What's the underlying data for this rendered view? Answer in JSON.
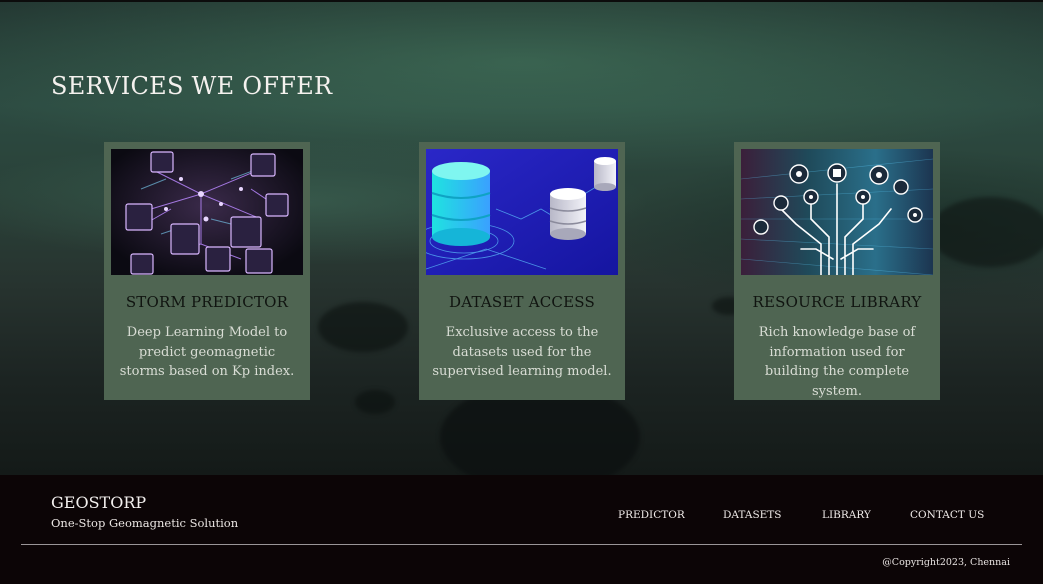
{
  "services": {
    "title": "SERVICES WE OFFER",
    "cards": [
      {
        "title": "STORM PREDICTOR",
        "description": "Deep Learning Model to predict geomagnetic storms based on Kp index.",
        "image": "network-cubes-illustration"
      },
      {
        "title": "DATASET ACCESS",
        "description": "Exclusive access to the datasets used for the supervised learning model.",
        "image": "database-cylinders-illustration"
      },
      {
        "title": "RESOURCE LIBRARY",
        "description": "Rich knowledge base of information used for building the complete system.",
        "image": "circuit-tree-icons-illustration"
      }
    ]
  },
  "footer": {
    "brand": "GEOSTORP",
    "tagline": "One-Stop Geomagnetic Solution",
    "nav": [
      "PREDICTOR",
      "DATASETS",
      "LIBRARY",
      "CONTACT US"
    ],
    "copyright": "@Copyright2023, Chennai"
  },
  "colors": {
    "card_background": "#4f6552",
    "footer_background": "#0c0506",
    "hero_tint": "#2c4a41"
  }
}
